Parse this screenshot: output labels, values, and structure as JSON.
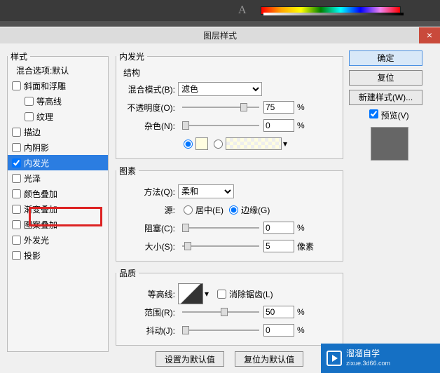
{
  "app": {
    "title": "图层样式",
    "close": "×"
  },
  "leftPanel": {
    "legend": "样式",
    "defaultLabel": "混合选项:默认",
    "items": [
      {
        "label": "斜面和浮雕",
        "checked": false
      },
      {
        "label": "等高线",
        "checked": false,
        "indent": true
      },
      {
        "label": "纹理",
        "checked": false,
        "indent": true
      },
      {
        "label": "描边",
        "checked": false
      },
      {
        "label": "内阴影",
        "checked": false
      },
      {
        "label": "内发光",
        "checked": true,
        "selected": true
      },
      {
        "label": "光泽",
        "checked": false
      },
      {
        "label": "颜色叠加",
        "checked": false
      },
      {
        "label": "渐变叠加",
        "checked": false
      },
      {
        "label": "图案叠加",
        "checked": false
      },
      {
        "label": "外发光",
        "checked": false
      },
      {
        "label": "投影",
        "checked": false
      }
    ]
  },
  "mainTitle": "内发光",
  "groups": {
    "structure": {
      "legend": "结构",
      "blendMode": {
        "label": "混合模式(B):",
        "value": "滤色"
      },
      "opacity": {
        "label": "不透明度(O):",
        "value": "75",
        "unit": "%"
      },
      "noise": {
        "label": "杂色(N):",
        "value": "0",
        "unit": "%"
      },
      "swatchColor": "#fffde0"
    },
    "element": {
      "legend": "图素",
      "technique": {
        "label": "方法(Q):",
        "value": "柔和"
      },
      "source": {
        "label": "源:",
        "center": "居中(E)",
        "edge": "边缘(G)"
      },
      "choke": {
        "label": "阻塞(C):",
        "value": "0",
        "unit": "%"
      },
      "size": {
        "label": "大小(S):",
        "value": "5",
        "unit": "像素"
      }
    },
    "quality": {
      "legend": "品质",
      "contour": {
        "label": "等高线:",
        "antialias": "消除锯齿(L)"
      },
      "range": {
        "label": "范围(R):",
        "value": "50",
        "unit": "%"
      },
      "jitter": {
        "label": "抖动(J):",
        "value": "0",
        "unit": "%"
      }
    }
  },
  "bottom": {
    "setDefault": "设置为默认值",
    "resetDefault": "复位为默认值"
  },
  "right": {
    "ok": "确定",
    "cancel": "复位",
    "newStyle": "新建样式(W)...",
    "preview": "预览(V)"
  },
  "watermark": {
    "main": "溜溜自学",
    "sub": "zixue.3d66.com"
  }
}
